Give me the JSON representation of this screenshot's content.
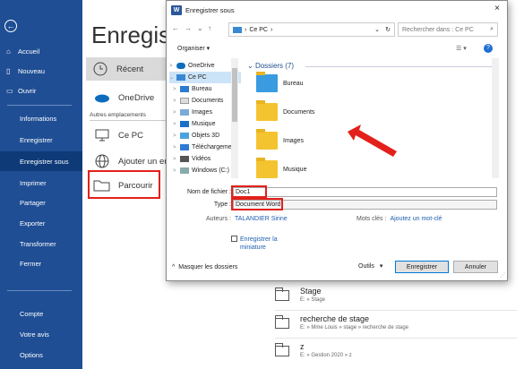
{
  "sidebar": {
    "back_icon": "back-arrow-icon",
    "items": [
      {
        "label": "Accueil",
        "icon": "home-icon"
      },
      {
        "label": "Nouveau",
        "icon": "new-document-icon"
      },
      {
        "label": "Ouvrir",
        "icon": "open-folder-icon"
      },
      {
        "label": "Informations"
      },
      {
        "label": "Enregistrer"
      },
      {
        "label": "Enregistrer sous"
      },
      {
        "label": "Imprimer"
      },
      {
        "label": "Partager"
      },
      {
        "label": "Exporter"
      },
      {
        "label": "Transformer"
      },
      {
        "label": "Fermer"
      },
      {
        "label": "Compte"
      },
      {
        "label": "Votre avis"
      },
      {
        "label": "Options"
      }
    ]
  },
  "backstage": {
    "title": "Enregistr",
    "locations": {
      "recent": "Récent",
      "onedrive": "OneDrive",
      "autres_header": "Autres emplacements",
      "cepc": "Ce PC",
      "ajouter": "Ajouter un em",
      "parcourir": "Parcourir"
    },
    "recent_items": [
      {
        "name": "Stage",
        "path": "E: » Stage"
      },
      {
        "name": "recherche de stage",
        "path": "E: » Mme Louis » stage » recherche de stage"
      },
      {
        "name": "z",
        "path": "E: » Gestion 2020 » z"
      }
    ]
  },
  "dialog": {
    "title": "Enregistrer sous",
    "close": "×",
    "address": "Ce PC",
    "address_sep": "›",
    "search_placeholder": "Rechercher dans : Ce PC",
    "organiser": "Organiser ▾",
    "tree": [
      {
        "label": "OneDrive",
        "arrow": ">",
        "icon": "cloud-icon"
      },
      {
        "label": "Ce PC",
        "arrow": "⌄",
        "icon": "computer-icon"
      },
      {
        "label": "Bureau",
        "arrow": ">",
        "icon": "desktop-icon"
      },
      {
        "label": "Documents",
        "arrow": ">",
        "icon": "documents-icon"
      },
      {
        "label": "Images",
        "arrow": ">",
        "icon": "images-icon"
      },
      {
        "label": "Musique",
        "arrow": ">",
        "icon": "music-icon"
      },
      {
        "label": "Objets 3D",
        "arrow": ">",
        "icon": "objects3d-icon"
      },
      {
        "label": "Téléchargeme",
        "arrow": ">",
        "icon": "download-icon"
      },
      {
        "label": "Vidéos",
        "arrow": ">",
        "icon": "videos-icon"
      },
      {
        "label": "Windows (C:)",
        "arrow": ">",
        "icon": "drive-icon"
      }
    ],
    "group_label": "Dossiers (7)",
    "folders": [
      "Bureau",
      "Documents",
      "Images",
      "Musique"
    ],
    "filename_label": "Nom de fichier :",
    "filename_value": "Doc1",
    "type_label": "Type :",
    "type_value": "Document Word",
    "auteurs_label": "Auteurs :",
    "auteurs_value": "TALANDIER Sirine",
    "mots_label": "Mots clés :",
    "mots_value": "Ajoutez un mot-clé",
    "checkbox_label": "Enregistrer la miniature",
    "masquer": "Masquer les dossiers",
    "outils": "Outils",
    "enregistrer": "Enregistrer",
    "annuler": "Annuler"
  },
  "colors": {
    "sidebar": "#1f4e94",
    "highlight": "#e3201b",
    "accent": "#0078d7"
  }
}
